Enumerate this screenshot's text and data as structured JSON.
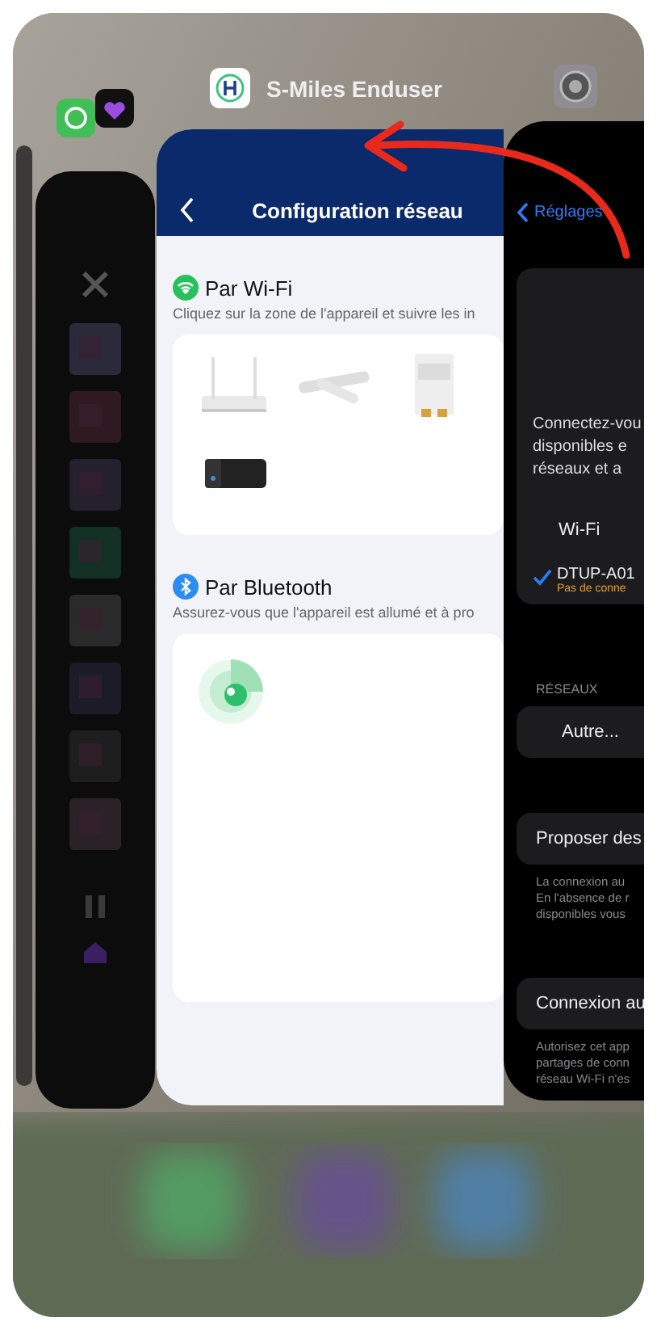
{
  "app_label": {
    "title": "S-Miles Enduser"
  },
  "config_card": {
    "title": "Configuration réseau",
    "sections": [
      {
        "kind": "wifi",
        "title": "Par Wi-Fi",
        "hint": "Cliquez sur la zone de l'appareil et suivre les in"
      },
      {
        "kind": "bluetooth",
        "title": "Par Bluetooth",
        "hint": "Assurez-vous que l'appareil est allumé et à pro"
      }
    ]
  },
  "settings_card": {
    "back": "Réglages",
    "intro_lines": [
      "Connectez-vou",
      "disponibles e",
      "réseaux et a"
    ],
    "wifi_label": "Wi-Fi",
    "network": {
      "name": "DTUP-A01",
      "status": "Pas de conne",
      "selected": true
    },
    "networks_header": "RÉSEAUX",
    "other": "Autre...",
    "options": [
      {
        "label": "Proposer des",
        "note_lines": [
          "La connexion au",
          "En l'absence de r",
          "disponibles vous"
        ]
      },
      {
        "label": "Connexion au",
        "note_lines": [
          "Autorisez cet app",
          "partages de conn",
          "réseau Wi-Fi n'es"
        ]
      }
    ]
  }
}
